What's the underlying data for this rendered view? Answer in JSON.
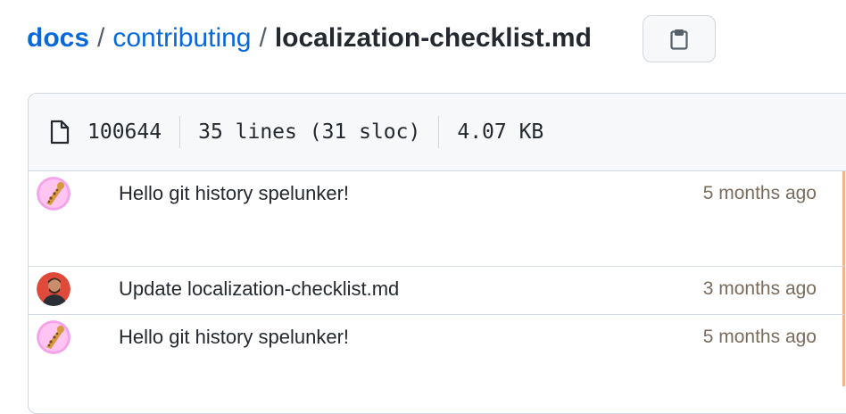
{
  "breadcrumb": {
    "repo": "docs",
    "separator": "/",
    "folder": "contributing",
    "file": "localization-checklist.md"
  },
  "copy_button": {
    "icon": "clipboard-icon"
  },
  "file_info": {
    "mode": "100644",
    "lines": "35 lines (31 sloc)",
    "size": "4.07 KB"
  },
  "blame": [
    {
      "message": "Hello git history spelunker!",
      "age": "5 months ago",
      "avatar": "giraffe-avatar",
      "age_color": "#f0b48c"
    },
    {
      "message": "Update localization-checklist.md",
      "age": "3 months ago",
      "avatar": "user-photo-avatar",
      "age_color": "#f0b48c"
    },
    {
      "message": "Hello git history spelunker!",
      "age": "5 months ago",
      "avatar": "giraffe-avatar",
      "age_color": "#f0b48c"
    }
  ],
  "colors": {
    "link": "#0969da",
    "border": "#d0d7de",
    "header_bg": "#f6f8fa",
    "age_bar": "#f0b48c"
  }
}
